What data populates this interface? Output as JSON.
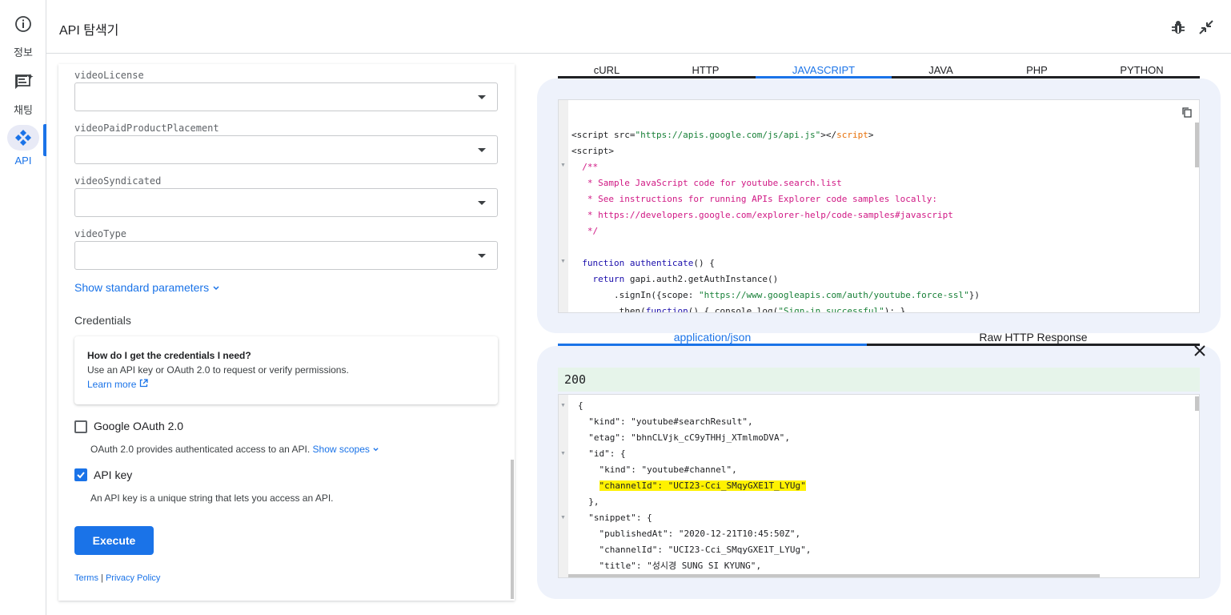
{
  "rail": {
    "items": [
      {
        "label": "정보",
        "icon": "info-icon"
      },
      {
        "label": "채팅",
        "icon": "chat-spark-icon"
      },
      {
        "label": "API",
        "icon": "api-icon"
      }
    ]
  },
  "header": {
    "title": "API 탐색기",
    "actions": [
      "bug-icon",
      "collapse-icon"
    ]
  },
  "form": {
    "fields": [
      {
        "label": "videoLicense",
        "value": ""
      },
      {
        "label": "videoPaidProductPlacement",
        "value": ""
      },
      {
        "label": "videoSyndicated",
        "value": ""
      },
      {
        "label": "videoType",
        "value": ""
      }
    ],
    "show_standard": "Show standard parameters",
    "credentials_title": "Credentials",
    "cred_question": "How do I get the credentials I need?",
    "cred_answer": "Use an API key or OAuth 2.0 to request or verify permissions.",
    "learn_more": "Learn more",
    "oauth_label": "Google OAuth 2.0",
    "oauth_checked": false,
    "oauth_desc": "OAuth 2.0 provides authenticated access to an API.",
    "show_scopes": "Show scopes",
    "apikey_label": "API key",
    "apikey_checked": true,
    "apikey_desc": "An API key is a unique string that lets you access an API.",
    "execute": "Execute",
    "terms": "Terms",
    "sep": "|",
    "privacy": "Privacy Policy"
  },
  "code": {
    "tabs": [
      "cURL",
      "HTTP",
      "JAVASCRIPT",
      "JAVA",
      "PHP",
      "PYTHON"
    ],
    "active_tab": "JAVASCRIPT",
    "lines": {
      "l1a": "<script src=",
      "l1b": "\"https://apis.google.com/js/api.js\"",
      "l1c": "></",
      "l1d": "script",
      "l1e": ">",
      "l2": "<script>",
      "l3": "/**",
      "l4": " * Sample JavaScript code for youtube.search.list",
      "l5": " * See instructions for running APIs Explorer code samples locally:",
      "l6": " * https://developers.google.com/explorer-help/code-samples#javascript",
      "l7": " */",
      "l8a": "function",
      "l8b": "authenticate",
      "l8c": "() {",
      "l9a": "return",
      "l9b": " gapi.auth2.getAuthInstance()",
      "l10a": "    .signIn({scope: ",
      "l10b": "\"https://www.googleapis.com/auth/youtube.force-ssl\"",
      "l10c": "})",
      "l11a": "    .then(",
      "l11b": "function",
      "l11c": "() { console.log(",
      "l11d": "\"Sign-in successful\"",
      "l11e": "); },"
    }
  },
  "response": {
    "tabs": [
      "application/json",
      "Raw HTTP Response"
    ],
    "active_tab": "application/json",
    "status": "200",
    "json": {
      "j1": "{",
      "j2k": "\"kind\"",
      "j2v": "\"youtube#searchResult\"",
      "j3k": "\"etag\"",
      "j3v": "\"bhnCLVjk_cC9yTHHj_XTmlmoDVA\"",
      "j4k": "\"id\"",
      "j5k": "\"kind\"",
      "j5v": "\"youtube#channel\"",
      "j6k": "\"channelId\"",
      "j6v": "\"UCI23-Cci_SMqyGXE1T_LYUg\"",
      "j7": "},",
      "j8k": "\"snippet\"",
      "j9k": "\"publishedAt\"",
      "j9v": "\"2020-12-21T10:45:50Z\"",
      "j10k": "\"channelId\"",
      "j10v": "\"UCI23-Cci_SMqyGXE1T_LYUg\"",
      "j11k": "\"title\"",
      "j11v": "\"성시경 SUNG SI KYUNG\""
    }
  },
  "colors": {
    "accent": "#1a73e8",
    "highlight": "#fff200",
    "status_bg": "#e6f4ea",
    "card_bg": "#eef2fb"
  }
}
